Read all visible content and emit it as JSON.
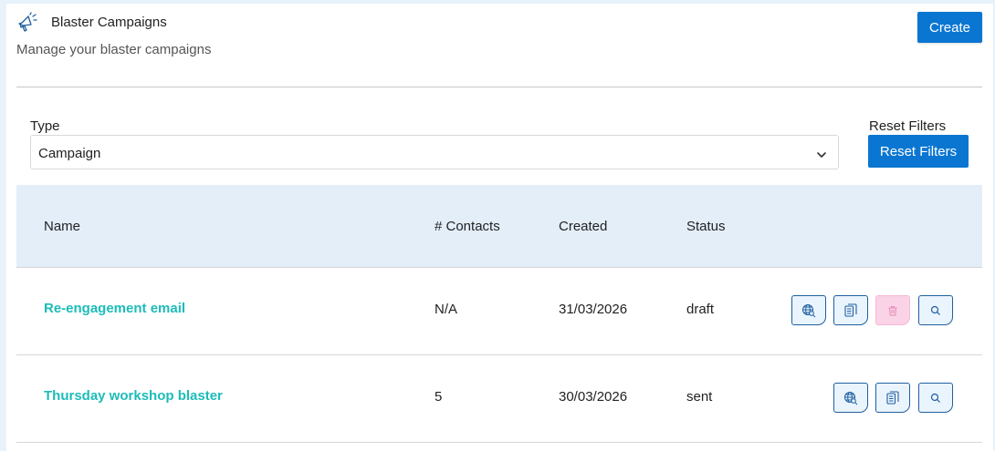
{
  "header": {
    "title": "Blaster Campaigns",
    "subtitle": "Manage your blaster campaigns",
    "create_label": "Create",
    "icon": "megaphone-icon"
  },
  "filters": {
    "type_label": "Type",
    "type_value": "Campaign",
    "reset_label": "Reset Filters",
    "reset_button": "Reset Filters"
  },
  "table": {
    "columns": [
      "Name",
      "# Contacts",
      "Created",
      "Status"
    ],
    "rows": [
      {
        "name": "Re-engagement email",
        "contacts": "N/A",
        "created": "31/03/2026",
        "status": "draft",
        "actions": [
          "globe-search-icon",
          "copy-icon",
          "trash-icon",
          "search-icon"
        ]
      },
      {
        "name": "Thursday workshop blaster",
        "contacts": "5",
        "created": "30/03/2026",
        "status": "sent",
        "actions": [
          "globe-search-icon",
          "copy-icon",
          "search-icon"
        ]
      }
    ]
  },
  "colors": {
    "primary": "#0b76d1",
    "link": "#1cbcb8",
    "header_bg": "#e3eef9",
    "delete_bg": "#fbd3e6"
  }
}
